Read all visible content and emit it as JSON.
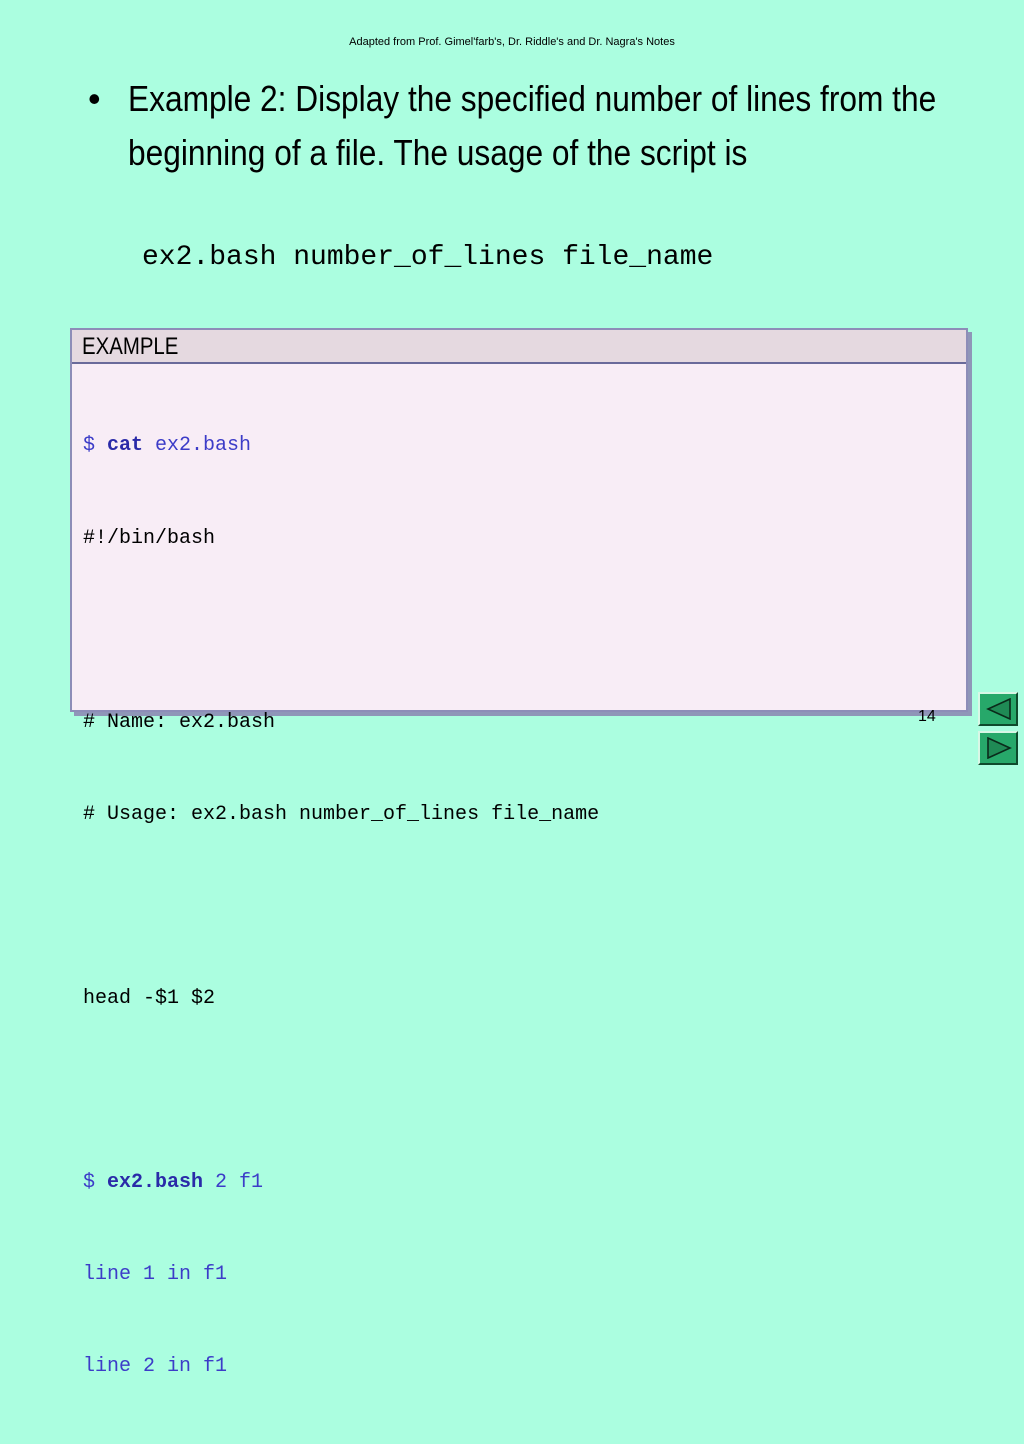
{
  "header": {
    "note": "Adapted from Prof. Gimel'farb's,  Dr. Riddle's and Dr. Nagra's Notes"
  },
  "bullet": {
    "marker": "•",
    "text": "Example 2: Display the specified number of lines from the beginning of a file. The usage of the script is"
  },
  "usage": {
    "line": "ex2.bash number_of_lines file_name"
  },
  "example": {
    "title": "EXAMPLE",
    "lines": {
      "l1": {
        "prompt": "$ ",
        "cmd": "cat",
        "args": " ex2.bash"
      },
      "l2": "#!/bin/bash",
      "l3": "",
      "l4": "# Name: ex2.bash",
      "l5": "# Usage: ex2.bash number_of_lines file_name",
      "l6": "",
      "l7": "head -$1 $2",
      "l8": "",
      "l9": {
        "prompt": "$ ",
        "cmd": "ex2.bash",
        "args": " 2 f1"
      },
      "l10": "line 1 in f1",
      "l11": "line 2 in f1"
    }
  },
  "footer": {
    "page_number": "14"
  },
  "nav": {
    "prev_icon": "triangle-left-icon",
    "next_icon": "triangle-right-icon"
  },
  "colors": {
    "background": "#abfee0",
    "box_background": "#f8edf6",
    "header_background": "#e5d9e0",
    "command_blue": "#3c3cc8",
    "nav_green": "#27a86a"
  }
}
